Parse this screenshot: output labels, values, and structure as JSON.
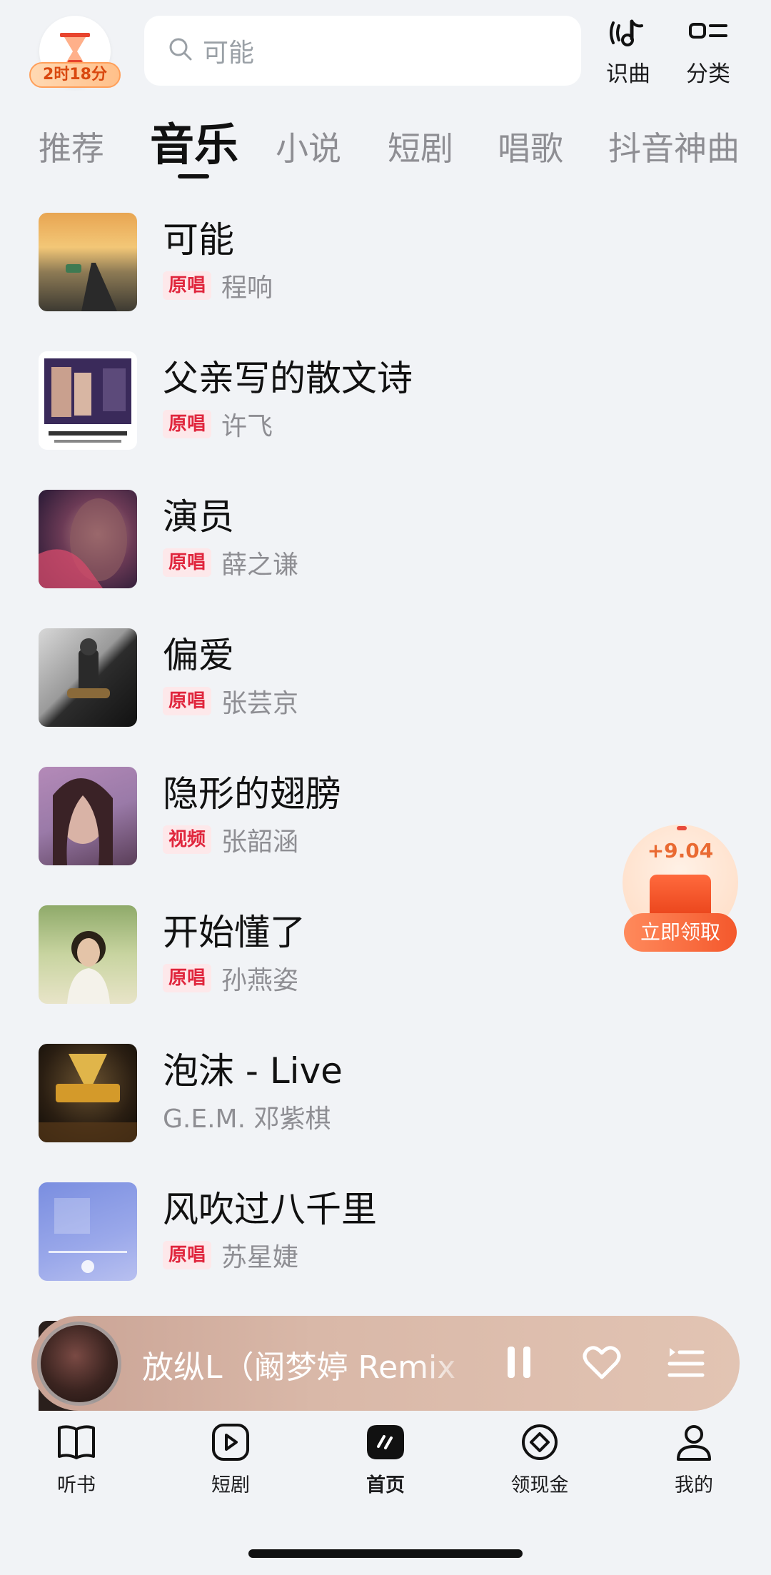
{
  "timer": {
    "text": "2时18分"
  },
  "search": {
    "placeholder": "可能"
  },
  "top_actions": [
    {
      "label": "识曲",
      "icon": "music-recognition-icon"
    },
    {
      "label": "分类",
      "icon": "category-icon"
    }
  ],
  "tabs": [
    {
      "label": "推荐",
      "active": false
    },
    {
      "label": "音乐",
      "active": true
    },
    {
      "label": "小说",
      "active": false
    },
    {
      "label": "短剧",
      "active": false
    },
    {
      "label": "唱歌",
      "active": false
    },
    {
      "label": "抖音神曲",
      "active": false
    }
  ],
  "songs": [
    {
      "title": "可能",
      "tag": "原唱",
      "artist": "程响"
    },
    {
      "title": "父亲写的散文诗",
      "tag": "原唱",
      "artist": "许飞"
    },
    {
      "title": "演员",
      "tag": "原唱",
      "artist": "薛之谦"
    },
    {
      "title": "偏爱",
      "tag": "原唱",
      "artist": "张芸京"
    },
    {
      "title": "隐形的翅膀",
      "tag": "视频",
      "artist": "张韶涵"
    },
    {
      "title": "开始懂了",
      "tag": "原唱",
      "artist": "孙燕姿"
    },
    {
      "title": "泡沫 - Live",
      "tag": "",
      "artist": "G.E.M. 邓紫棋"
    },
    {
      "title": "风吹过八千里",
      "tag": "原唱",
      "artist": "苏星婕"
    }
  ],
  "reward": {
    "amount": "+9.04",
    "button": "立即领取"
  },
  "player": {
    "title": "放纵L（阚梦婷 Remix"
  },
  "bottom_nav": [
    {
      "label": "听书",
      "icon": "book-icon",
      "active": false
    },
    {
      "label": "短剧",
      "icon": "play-icon",
      "active": false
    },
    {
      "label": "首页",
      "icon": "home-icon",
      "active": true
    },
    {
      "label": "领现金",
      "icon": "cash-icon",
      "active": false
    },
    {
      "label": "我的",
      "icon": "profile-icon",
      "active": false
    }
  ],
  "colors": {
    "accent": "#e0263d",
    "background": "#f1f3f6",
    "reward_orange": "#f4582c"
  }
}
